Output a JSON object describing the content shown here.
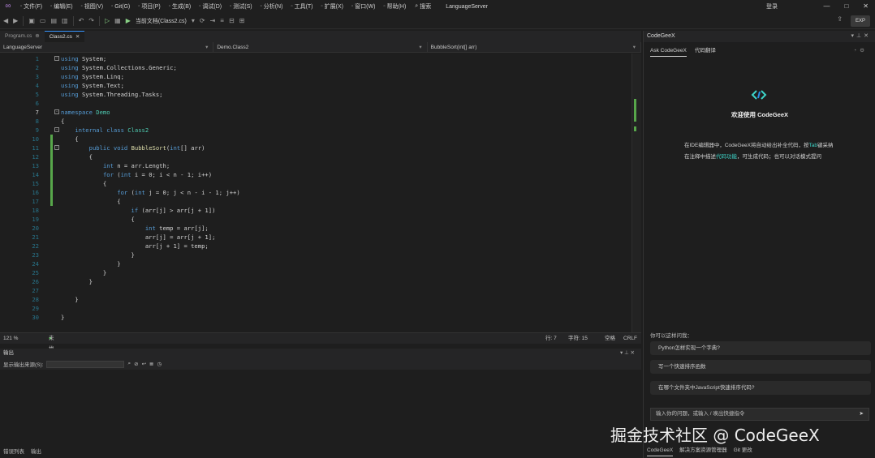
{
  "menubar": {
    "items": [
      {
        "label": "文件(F)",
        "icon": "file-icon"
      },
      {
        "label": "编辑(E)",
        "icon": "edit-icon"
      },
      {
        "label": "视图(V)",
        "icon": "view-icon"
      },
      {
        "label": "Git(G)",
        "icon": "git-icon"
      },
      {
        "label": "项目(P)",
        "icon": "project-icon"
      },
      {
        "label": "生成(B)",
        "icon": "build-icon"
      },
      {
        "label": "调试(D)",
        "icon": "debug-icon"
      },
      {
        "label": "测试(S)",
        "icon": "test-icon"
      },
      {
        "label": "分析(N)",
        "icon": "analyze-icon"
      },
      {
        "label": "工具(T)",
        "icon": "tools-icon"
      },
      {
        "label": "扩展(X)",
        "icon": "extensions-icon"
      },
      {
        "label": "窗口(W)",
        "icon": "window-icon"
      },
      {
        "label": "帮助(H)",
        "icon": "help-icon"
      }
    ],
    "search_label": "搜索",
    "solution_name": "LanguageServer",
    "user": "登录",
    "window_controls": [
      "—",
      "□",
      "✕"
    ]
  },
  "toolbar": {
    "run_label": "当前文档(Class2.cs)",
    "ext_label": "EXP"
  },
  "editor": {
    "tabs": [
      {
        "label": "Program.cs",
        "active": false
      },
      {
        "label": "Class2.cs",
        "active": true
      }
    ],
    "nav": {
      "project": "LanguageServer",
      "class": "Demo.Class2",
      "member": "BubbleSort(int[] arr)"
    },
    "lines": [
      {
        "n": "1",
        "code": "using System;"
      },
      {
        "n": "2",
        "code": "using System.Collections.Generic;"
      },
      {
        "n": "3",
        "code": "using System.Linq;"
      },
      {
        "n": "4",
        "code": "using System.Text;"
      },
      {
        "n": "5",
        "code": "using System.Threading.Tasks;"
      },
      {
        "n": "6",
        "code": ""
      },
      {
        "n": "7",
        "code": "namespace Demo"
      },
      {
        "n": "8",
        "code": "{"
      },
      {
        "n": "9",
        "code": "    internal class Class2"
      },
      {
        "n": "10",
        "code": "    {"
      },
      {
        "n": "11",
        "code": "        public void BubbleSort(int[] arr)"
      },
      {
        "n": "12",
        "code": "        {"
      },
      {
        "n": "13",
        "code": "            int n = arr.Length;"
      },
      {
        "n": "14",
        "code": "            for (int i = 0; i < n - 1; i++)"
      },
      {
        "n": "15",
        "code": "            {"
      },
      {
        "n": "16",
        "code": "                for (int j = 0; j < n - i - 1; j++)"
      },
      {
        "n": "17",
        "code": "                {"
      },
      {
        "n": "18",
        "code": "                    if (arr[j] > arr[j + 1])"
      },
      {
        "n": "19",
        "code": "                    {"
      },
      {
        "n": "20",
        "code": "                        int temp = arr[j];"
      },
      {
        "n": "21",
        "code": "                        arr[j] = arr[j + 1];"
      },
      {
        "n": "22",
        "code": "                        arr[j + 1] = temp;"
      },
      {
        "n": "23",
        "code": "                    }"
      },
      {
        "n": "24",
        "code": "                }"
      },
      {
        "n": "25",
        "code": "            }"
      },
      {
        "n": "26",
        "code": "        }"
      },
      {
        "n": "27",
        "code": ""
      },
      {
        "n": "28",
        "code": "    }"
      },
      {
        "n": "29",
        "code": ""
      },
      {
        "n": "30",
        "code": "}"
      }
    ],
    "status": {
      "zoom": "121 %",
      "issues": "未找到相关问题",
      "line": "行: 7",
      "col": "字符: 15",
      "ins": "空格",
      "eol": "CRLF"
    }
  },
  "output": {
    "title": "输出",
    "source_label": "显示输出来源(S):",
    "bottom_tabs": [
      "错误列表",
      "输出"
    ]
  },
  "codegeex": {
    "panel_title": "CodeGeeX",
    "tabs": [
      "Ask CodeGeeX",
      "代码翻译"
    ],
    "welcome": "欢迎使用 CodeGeeX",
    "intro_line1_a": "在IDE编辑器中，CodeGeeX将自动给出补全代码，按",
    "intro_line1_hl": "Tab",
    "intro_line1_b": "键采纳",
    "intro_line2_a": "在注释中描述",
    "intro_line2_hl": "代码功能",
    "intro_line2_b": "，可生成代码；也可以对话模式提问",
    "ask_label": "你可以这样问我：",
    "suggestions": [
      "Python怎样实现一个字典?",
      "写一个快速排序函数",
      "在哪个文件夹中JavaScript快速排序代码?"
    ],
    "input_placeholder": "输入你的问题，或输入 / 唤出快捷指令",
    "footer": [
      "CodeGeeX",
      "解决方案资源管理器",
      "Git 更改"
    ]
  },
  "watermark": "掘金技术社区 @ CodeGeeX",
  "colors": {
    "accent": "#3794ff",
    "keyword": "#569cd6",
    "type": "#4ec9b0",
    "change_bar": "#57a64a",
    "brand": "#3dd5c9"
  }
}
